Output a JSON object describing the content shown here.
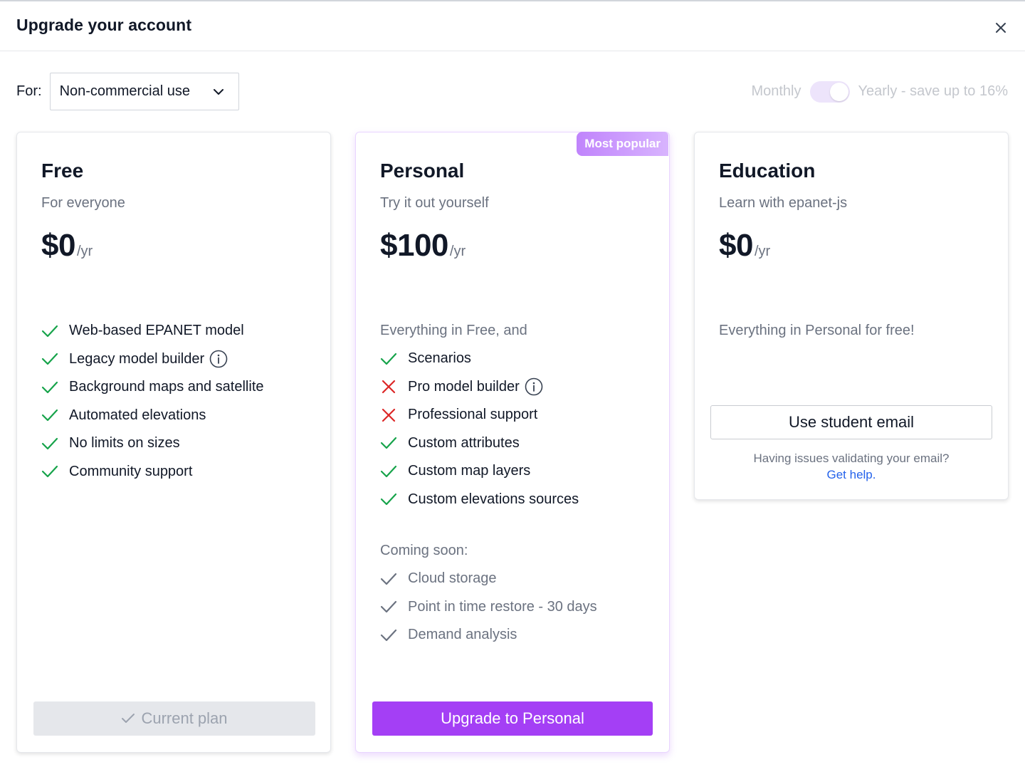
{
  "dialog": {
    "title": "Upgrade your account"
  },
  "toolbar": {
    "for_label": "For:",
    "selected_use": "Non-commercial use",
    "billing_monthly": "Monthly",
    "billing_yearly": "Yearly - save up to 16%",
    "billing_period_selected": "Yearly"
  },
  "plans": {
    "free": {
      "name": "Free",
      "subtitle": "For everyone",
      "price": "$0",
      "unit": "/yr",
      "features": [
        "Web-based EPANET model",
        "Legacy model builder",
        "Background maps and satellite",
        "Automated elevations",
        "No limits on sizes",
        "Community support"
      ],
      "button": "Current plan"
    },
    "personal": {
      "badge": "Most popular",
      "name": "Personal",
      "subtitle": "Try it out yourself",
      "price": "$100",
      "unit": "/yr",
      "intro": "Everything in Free, and",
      "features": [
        "Scenarios",
        "Pro model builder",
        "Professional support",
        "Custom attributes",
        "Custom map layers",
        "Custom elevations sources"
      ],
      "coming_soon_label": "Coming soon:",
      "coming_soon": [
        "Cloud storage",
        "Point in time restore - 30 days",
        "Demand analysis"
      ],
      "button": "Upgrade to Personal"
    },
    "education": {
      "name": "Education",
      "subtitle": "Learn with epanet-js",
      "price": "$0",
      "unit": "/yr",
      "intro": "Everything in Personal for free!",
      "button": "Use student email",
      "help_text": "Having issues validating your email?",
      "help_link": "Get help."
    }
  },
  "colors": {
    "accent": "#a43ff5",
    "check_green": "#16a34a",
    "cross_red": "#dc2626"
  }
}
